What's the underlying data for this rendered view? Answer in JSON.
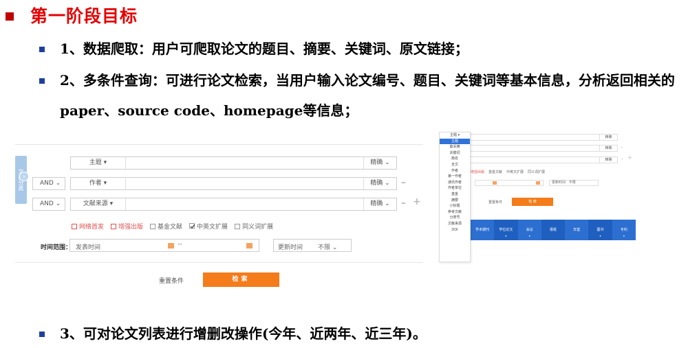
{
  "title": "第一阶段目标",
  "items": [
    "1、数据爬取：用户可爬取论文的题目、摘要、关键词、原文链接；",
    "2、多条件查询：可进行论文检索，当用户输入论文编号、题目、关键词等基本信息，分析返回相关的paper、source code、homepage等信息；",
    "3、可对论文列表进行增删改操作(今年、近两年、近三年)。"
  ],
  "search_form": {
    "side_tab": "文献分类",
    "and_labels": [
      "AND",
      "AND"
    ],
    "fields": [
      "主题",
      "作者",
      "文献来源"
    ],
    "exact_label": "精确",
    "checkboxes": [
      {
        "label": "网络首发",
        "checked": false,
        "style": "red"
      },
      {
        "label": "增强出版",
        "checked": false,
        "style": "red"
      },
      {
        "label": "基金文献",
        "checked": false,
        "style": "normal"
      },
      {
        "label": "中英文扩展",
        "checked": true,
        "style": "normal"
      },
      {
        "label": "同义词扩展",
        "checked": false,
        "style": "normal"
      }
    ],
    "time_label": "时间范围：",
    "publish_time_placeholder": "发表时间",
    "range_separator": "--",
    "update_time_label": "更新时间",
    "update_time_value": "不限",
    "reset_label": "重置条件",
    "search_label": "检索"
  },
  "right_shot": {
    "field_options": [
      "主题",
      "篇关摘",
      "关键词",
      "篇名",
      "全文",
      "作者",
      "第一作者",
      "通讯作者",
      "作者单位",
      "基金",
      "摘要",
      "小标题",
      "参考文献",
      "分类号",
      "文献来源",
      "DOI"
    ],
    "selected_option": "主题",
    "exact_label": "精确",
    "checkboxes": [
      "增强出版",
      "基金文献",
      "中英文扩展",
      "同义词扩展"
    ],
    "update_time_label": "更新时间",
    "update_time_value": "不限",
    "reset_label": "重置条件",
    "search_label": "检 索",
    "nav_items": [
      "学术期刊",
      "学位论文",
      "会议",
      "报纸",
      "年鉴",
      "图书",
      "专利"
    ]
  }
}
